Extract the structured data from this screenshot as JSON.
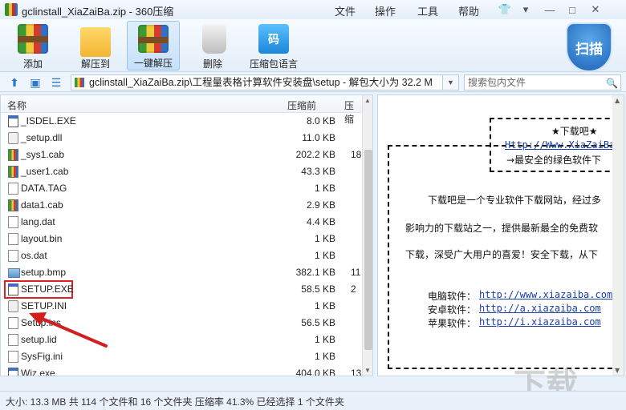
{
  "window": {
    "title": "gclinstall_XiaZaiBa.zip - 360压缩",
    "menus": [
      "文件",
      "操作",
      "工具",
      "帮助"
    ]
  },
  "toolbar": {
    "buttons": [
      {
        "label": "添加",
        "icon": "add-archive-icon"
      },
      {
        "label": "解压到",
        "icon": "extract-to-icon"
      },
      {
        "label": "一键解压",
        "icon": "one-click-extract-icon"
      },
      {
        "label": "删除",
        "icon": "delete-icon"
      },
      {
        "label": "压缩包语言",
        "icon": "archive-language-icon"
      }
    ],
    "scan_label": "扫描"
  },
  "address": {
    "path": "gclinstall_XiaZaiBa.zip\\工程量表格计算软件安装盘\\setup - 解包大小为 32.2 M",
    "search_placeholder": "搜索包内文件"
  },
  "filelist": {
    "headers": {
      "name": "名称",
      "size": "压缩前",
      "packed": "压缩"
    },
    "rows": [
      {
        "name": "_ISDEL.EXE",
        "size": "8.0 KB",
        "packed": "",
        "type": "exe"
      },
      {
        "name": "_setup.dll",
        "size": "11.0 KB",
        "packed": "",
        "type": "gear"
      },
      {
        "name": "_sys1.cab",
        "size": "202.2 KB",
        "packed": "18",
        "type": "cab"
      },
      {
        "name": "_user1.cab",
        "size": "43.3 KB",
        "packed": "",
        "type": "cab"
      },
      {
        "name": "DATA.TAG",
        "size": "1 KB",
        "packed": "",
        "type": "doc"
      },
      {
        "name": "data1.cab",
        "size": "2.9 KB",
        "packed": "",
        "type": "cab"
      },
      {
        "name": "lang.dat",
        "size": "4.4 KB",
        "packed": "",
        "type": "doc"
      },
      {
        "name": "layout.bin",
        "size": "1 KB",
        "packed": "",
        "type": "doc"
      },
      {
        "name": "os.dat",
        "size": "1 KB",
        "packed": "",
        "type": "doc"
      },
      {
        "name": "setup.bmp",
        "size": "382.1 KB",
        "packed": "11",
        "type": "bmp"
      },
      {
        "name": "SETUP.EXE",
        "size": "58.5 KB",
        "packed": "2",
        "type": "exe"
      },
      {
        "name": "SETUP.INI",
        "size": "1 KB",
        "packed": "",
        "type": "gear"
      },
      {
        "name": "Setup.ins",
        "size": "56.5 KB",
        "packed": "",
        "type": "doc"
      },
      {
        "name": "setup.lid",
        "size": "1 KB",
        "packed": "",
        "type": "doc"
      },
      {
        "name": "SysFig.ini",
        "size": "1 KB",
        "packed": "",
        "type": "doc"
      },
      {
        "name": "Wiz.exe",
        "size": "404.0 KB",
        "packed": "13",
        "type": "exe"
      }
    ]
  },
  "preview": {
    "star_title": "★下载吧★",
    "url_line": "Http://Www.XiaZaiBa",
    "tagline": "→最安全的绿色软件下",
    "para1": "下载吧是一个专业软件下载网站，经过多",
    "para2": "影响力的下载站之一，提供最新最全的免费软",
    "para3": "下载，深受广大用户的喜爱！安全下载，从下",
    "links": [
      {
        "label": "电脑软件：",
        "url": "http://www.xiazaiba.com"
      },
      {
        "label": "安卓软件：",
        "url": "http://a.xiazaiba.com"
      },
      {
        "label": "苹果软件：",
        "url": "http://i.xiazaiba.com"
      }
    ]
  },
  "status": {
    "text": "大小: 13.3 MB 共 114 个文件和 16 个文件夹 压缩率 41.3% 已经选择 1 个文件夹"
  },
  "colors": {
    "highlight": "#e02020",
    "accent": "#2a78c8"
  }
}
